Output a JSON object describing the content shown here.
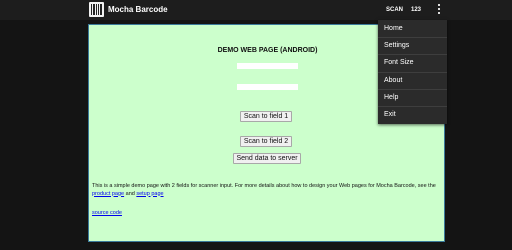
{
  "app": {
    "title": "Mocha Barcode"
  },
  "actionbar": {
    "scan_label": "SCAN",
    "count_label": "123"
  },
  "page": {
    "heading": "DEMO WEB PAGE (ANDROID)",
    "field1_value": "",
    "field2_value": "",
    "scan1_label": "Scan to field 1",
    "scan2_label": "Scan to field 2",
    "send_label": "Send data to server",
    "description_before": "This is a simple demo page with 2 fields for scanner input. For more details about how to design your Web pages for Mocha Barcode, see the ",
    "product_link": "product page",
    "description_and": " and ",
    "setup_link": "setup page",
    "source_link": "source code"
  },
  "menu": {
    "items": [
      {
        "label": "Home"
      },
      {
        "label": "Settings"
      },
      {
        "label": "Font Size"
      },
      {
        "label": "About"
      },
      {
        "label": "Help"
      },
      {
        "label": "Exit"
      }
    ]
  },
  "colors": {
    "content_bg": "#ccffcc",
    "actionbar_bg": "#1d1d1d",
    "menu_bg": "#2b2b2b",
    "link": "#0000ee"
  },
  "icons": {
    "app": "barcode-icon",
    "overflow": "overflow-menu-icon"
  }
}
